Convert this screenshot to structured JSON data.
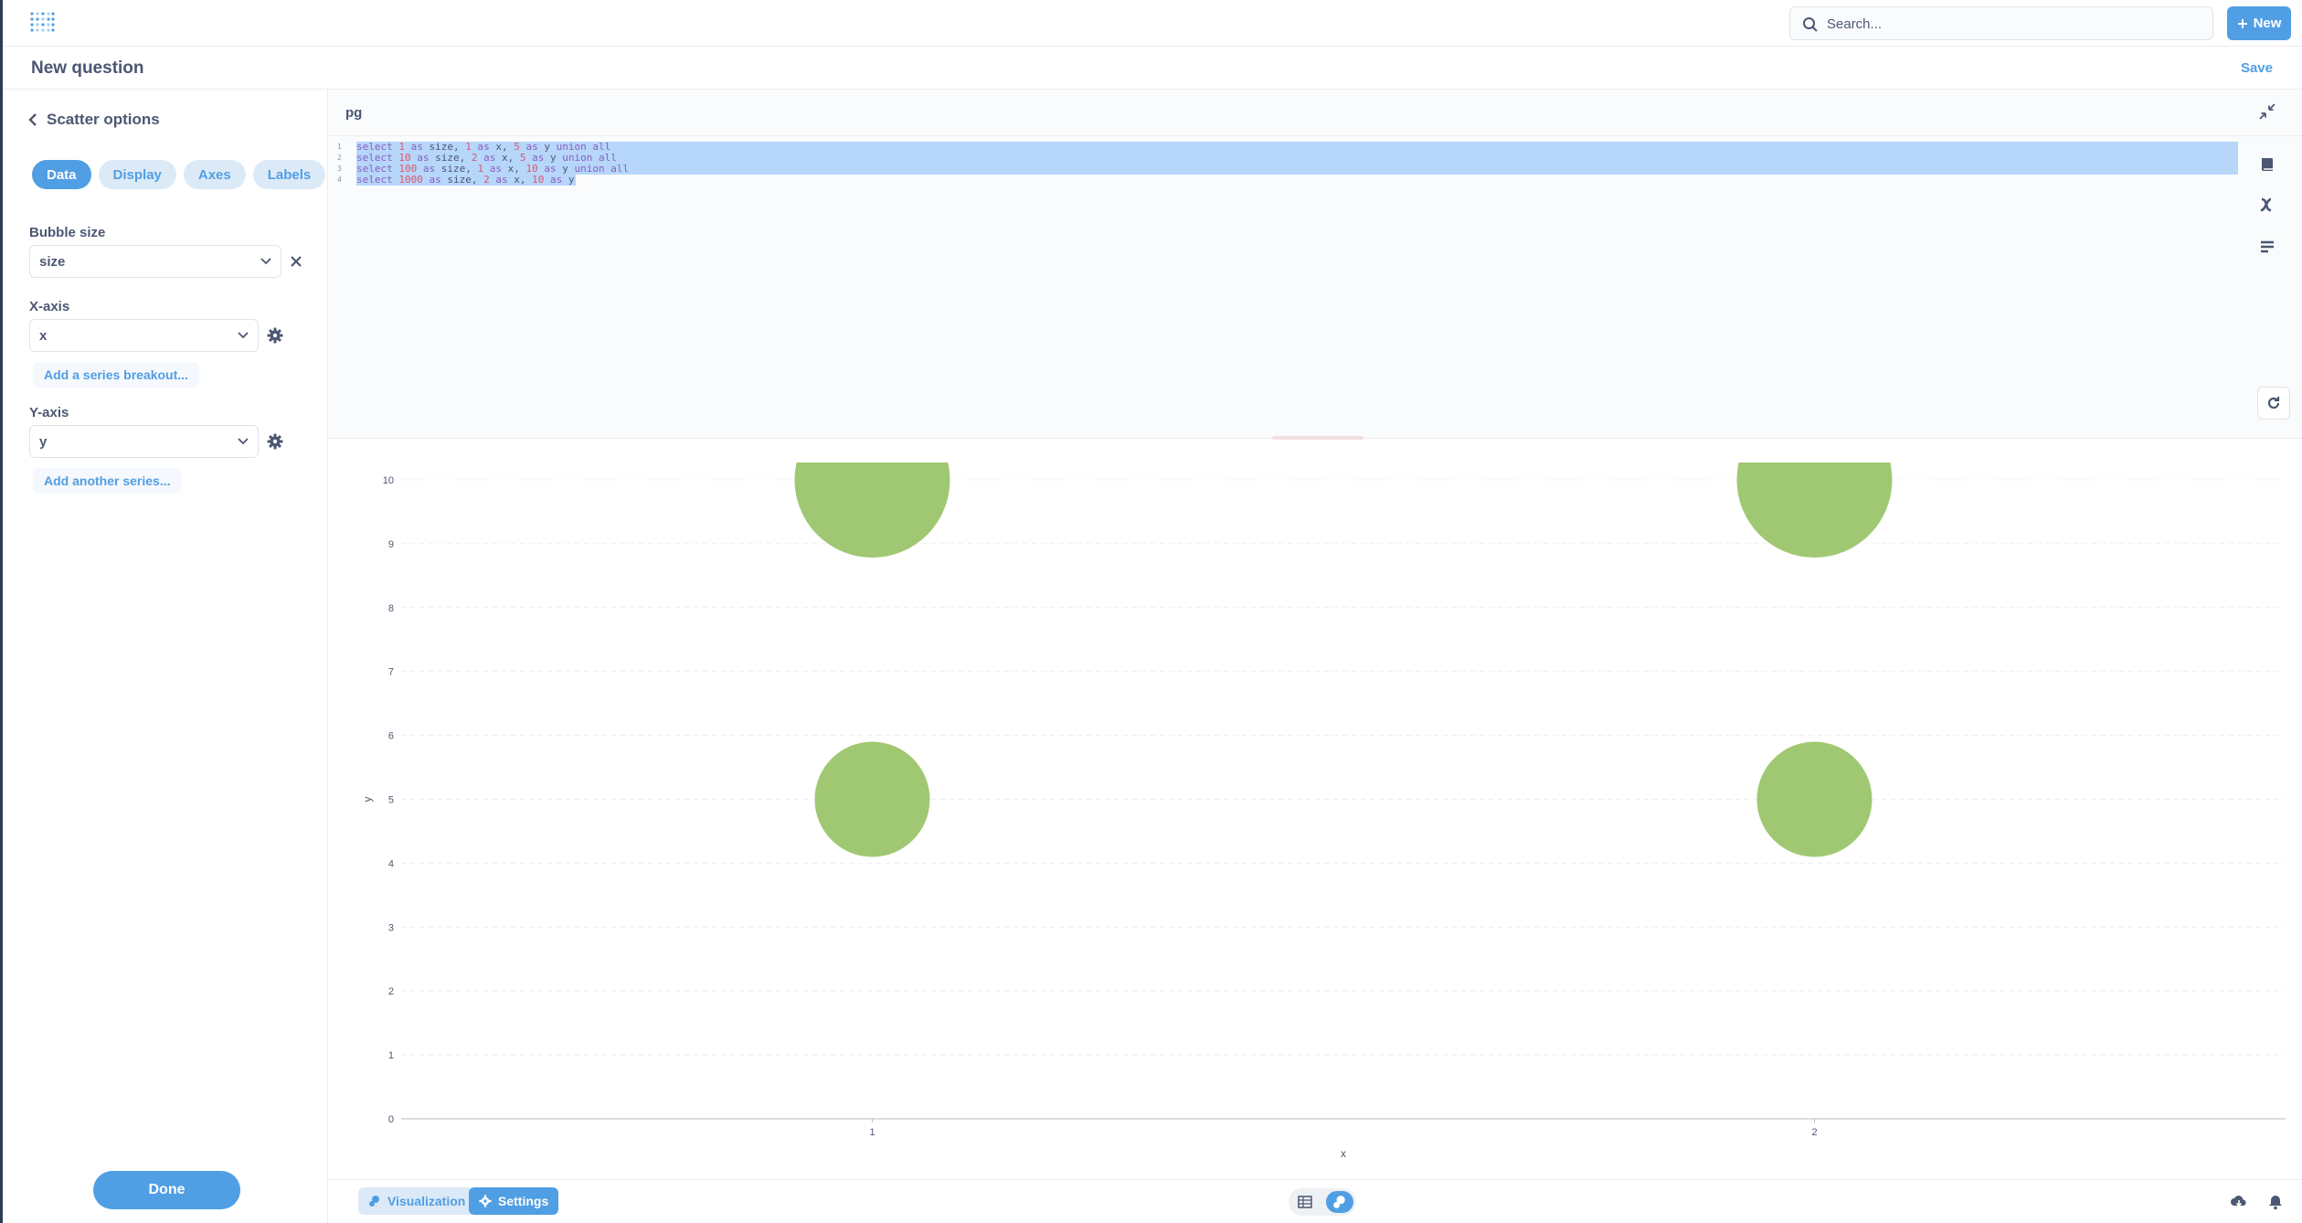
{
  "nav": {
    "search_placeholder": "Search...",
    "new_label": "New"
  },
  "header": {
    "title": "New question",
    "save_label": "Save"
  },
  "sidebar": {
    "back_label": "Scatter options",
    "tabs": [
      "Data",
      "Display",
      "Axes",
      "Labels"
    ],
    "active_tab": "Data",
    "bubble_size_label": "Bubble size",
    "bubble_size_value": "size",
    "x_axis_label": "X-axis",
    "x_axis_value": "x",
    "add_breakout_label": "Add a series breakout...",
    "y_axis_label": "Y-axis",
    "y_axis_value": "y",
    "add_series_label": "Add another series...",
    "done_label": "Done"
  },
  "editor": {
    "database": "pg",
    "lines": [
      {
        "n": "1",
        "tokens": [
          [
            "kw",
            "select "
          ],
          [
            "num",
            "1"
          ],
          [
            "kw",
            " as "
          ],
          [
            "id",
            "size, "
          ],
          [
            "num",
            "1"
          ],
          [
            "kw",
            " as "
          ],
          [
            "id",
            "x, "
          ],
          [
            "num",
            "5"
          ],
          [
            "kw",
            " as "
          ],
          [
            "id",
            "y "
          ],
          [
            "kw",
            "union all"
          ]
        ]
      },
      {
        "n": "2",
        "tokens": [
          [
            "kw",
            "select "
          ],
          [
            "num",
            "10"
          ],
          [
            "kw",
            " as "
          ],
          [
            "id",
            "size, "
          ],
          [
            "num",
            "2"
          ],
          [
            "kw",
            " as "
          ],
          [
            "id",
            "x, "
          ],
          [
            "num",
            "5"
          ],
          [
            "kw",
            " as "
          ],
          [
            "id",
            "y "
          ],
          [
            "kw",
            "union all"
          ]
        ]
      },
      {
        "n": "3",
        "tokens": [
          [
            "kw",
            "select "
          ],
          [
            "num",
            "100"
          ],
          [
            "kw",
            " as "
          ],
          [
            "id",
            "size, "
          ],
          [
            "num",
            "1"
          ],
          [
            "kw",
            " as "
          ],
          [
            "id",
            "x, "
          ],
          [
            "num",
            "10"
          ],
          [
            "kw",
            " as "
          ],
          [
            "id",
            "y "
          ],
          [
            "kw",
            "union all"
          ]
        ]
      },
      {
        "n": "4",
        "tokens": [
          [
            "kw",
            "select "
          ],
          [
            "num",
            "1000"
          ],
          [
            "kw",
            " as "
          ],
          [
            "id",
            "size, "
          ],
          [
            "num",
            "2"
          ],
          [
            "kw",
            " as "
          ],
          [
            "id",
            "x, "
          ],
          [
            "num",
            "10"
          ],
          [
            "kw",
            " as "
          ],
          [
            "id",
            "y"
          ]
        ]
      }
    ]
  },
  "chart_data": {
    "type": "scatter",
    "xlabel": "x",
    "ylabel": "y",
    "x_categories": [
      "1",
      "2"
    ],
    "ylim": [
      0,
      10
    ],
    "y_ticks": [
      "0",
      "1",
      "2",
      "3",
      "4",
      "5",
      "6",
      "7",
      "8",
      "9",
      "10"
    ],
    "points": [
      {
        "x": "1",
        "y": 5,
        "size": 1
      },
      {
        "x": "2",
        "y": 5,
        "size": 10
      },
      {
        "x": "1",
        "y": 10,
        "size": 100
      },
      {
        "x": "2",
        "y": 10,
        "size": 1000
      }
    ],
    "color": "#a0c872",
    "grid": true
  },
  "footer": {
    "visualization_label": "Visualization",
    "settings_label": "Settings"
  },
  "colors": {
    "brand": "#509ee3",
    "text": "#4c5773"
  }
}
